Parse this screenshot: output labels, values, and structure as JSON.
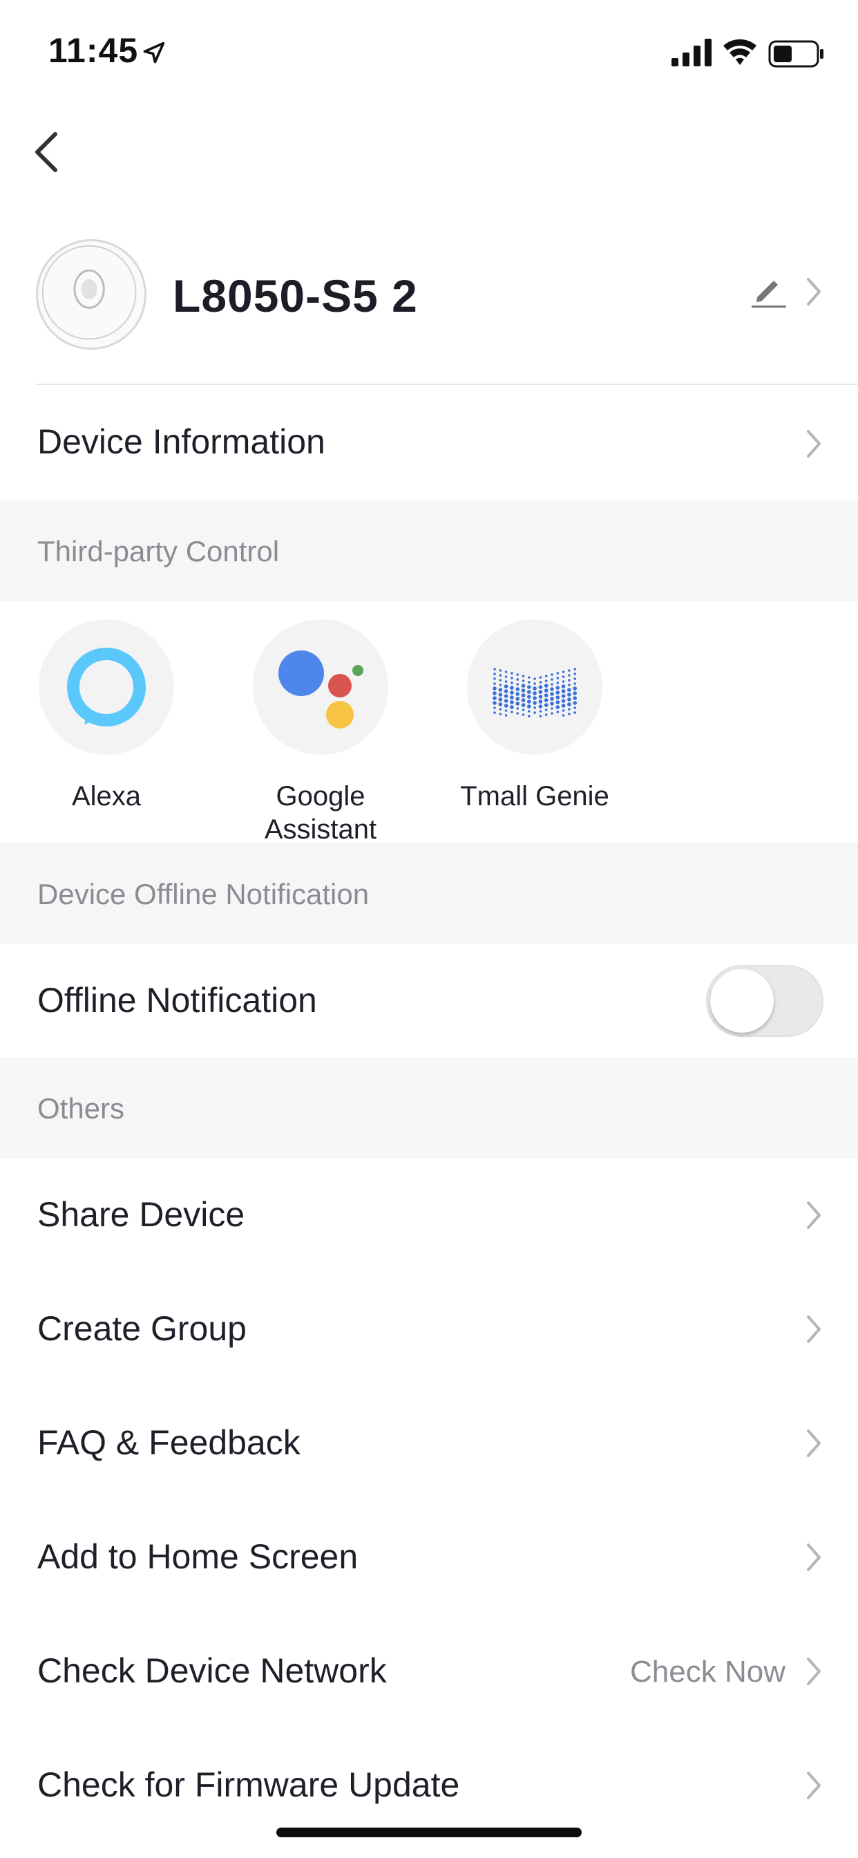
{
  "status_bar": {
    "time": "11:45",
    "icons": [
      "location-arrow-icon",
      "signal-icon",
      "wifi-icon",
      "battery-icon"
    ]
  },
  "header": {
    "back_icon": "chevron-left-icon",
    "device_name": "L8050-S5 2",
    "edit_icon": "pencil-icon"
  },
  "rows": {
    "device_information": "Device Information"
  },
  "sections": {
    "third_party": "Third-party Control",
    "offline": "Device Offline Notification",
    "others": "Others"
  },
  "third_party_items": [
    {
      "label": "Alexa",
      "icon": "alexa-icon"
    },
    {
      "label": "Google\nAssistant",
      "label_line1": "Google",
      "label_line2": "Assistant",
      "icon": "google-assistant-icon"
    },
    {
      "label": "Tmall Genie",
      "icon": "tmall-genie-icon"
    }
  ],
  "offline_notification": {
    "label": "Offline Notification",
    "enabled": false
  },
  "others_items": [
    {
      "label": "Share Device"
    },
    {
      "label": "Create Group"
    },
    {
      "label": "FAQ & Feedback"
    },
    {
      "label": "Add to Home Screen"
    },
    {
      "label": "Check Device Network",
      "value": "Check Now"
    },
    {
      "label": "Check for Firmware Update"
    }
  ],
  "colors": {
    "alexa": "#5ac8fa",
    "google_blue": "#4f86ec",
    "google_red": "#d9534f",
    "google_yellow": "#f6c343",
    "google_green": "#58a55c",
    "tmall_blue": "#3b6fd8",
    "section_bg": "#f6f6f7",
    "muted_text": "#8b8b93"
  }
}
